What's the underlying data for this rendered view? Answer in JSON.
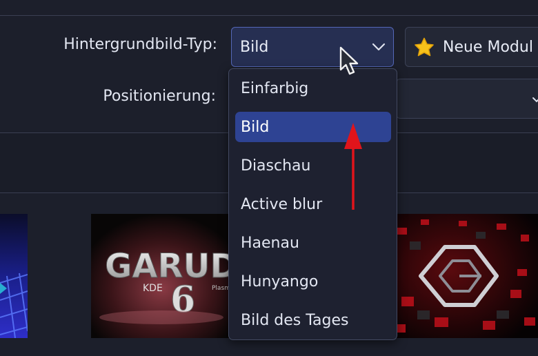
{
  "form": {
    "type_label": "Hintergrundbild-Typ:",
    "type_value": "Bild",
    "position_label": "Positionierung:",
    "new_modules_label": "Neue Modul"
  },
  "dropdown": {
    "options": [
      {
        "label": "Einfarbig",
        "selected": false
      },
      {
        "label": "Bild",
        "selected": true
      },
      {
        "label": "Diaschau",
        "selected": false
      },
      {
        "label": "Active blur",
        "selected": false
      },
      {
        "label": "Haenau",
        "selected": false
      },
      {
        "label": "Hunyango",
        "selected": false
      },
      {
        "label": "Bild des Tages",
        "selected": false
      }
    ]
  },
  "thumbnails": {
    "garuda_logo_text": "GARUDA",
    "garuda_sub_text": "KDE",
    "garuda_version": "6",
    "garuda_sub_right": "Plasma"
  },
  "colors": {
    "accent": "#2e4393",
    "combo_border": "#5568b8",
    "annotation_arrow": "#e0141b",
    "star": "#f7c21b"
  },
  "icons": [
    "chevron-down-icon",
    "star-icon",
    "mouse-cursor-icon",
    "red-arrow-annotation"
  ]
}
